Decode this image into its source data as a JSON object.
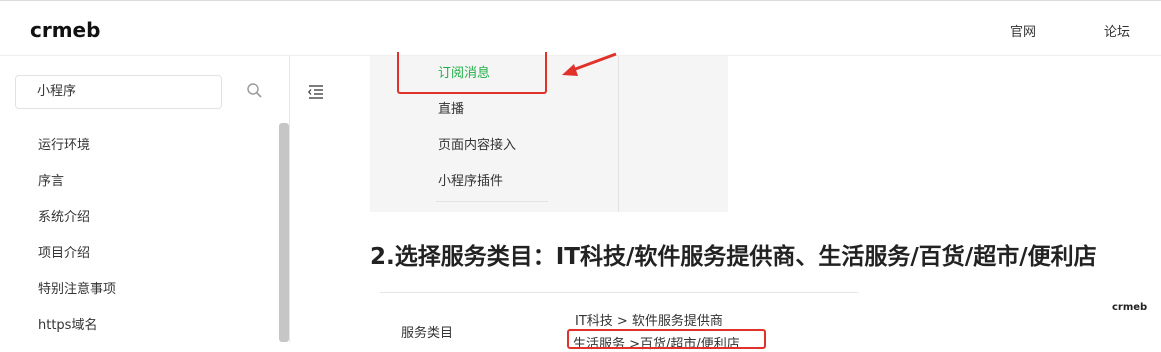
{
  "header": {
    "logo_text": "crmeb",
    "nav": [
      {
        "label": "官网"
      },
      {
        "label": "论坛"
      }
    ]
  },
  "sidebar": {
    "search_value": "小程序",
    "items": [
      {
        "label": "运行环境"
      },
      {
        "label": "序言"
      },
      {
        "label": "系统介绍"
      },
      {
        "label": "项目介绍"
      },
      {
        "label": "特别注意事项"
      },
      {
        "label": "https域名"
      }
    ]
  },
  "content": {
    "screenshot_menu": [
      {
        "label": "订阅消息",
        "active": true
      },
      {
        "label": "直播"
      },
      {
        "label": "页面内容接入"
      },
      {
        "label": "小程序插件"
      }
    ],
    "heading": "2.选择服务类目：IT科技/软件服务提供商、生活服务/百货/超市/便利店",
    "table": {
      "label": "服务类目",
      "value1": "IT科技 > 软件服务提供商",
      "value2": "生活服务 >百货/超市/便利店"
    },
    "watermark": "crmeb"
  },
  "colors": {
    "accent_green": "#21b04a",
    "highlight_red": "#e0322b"
  }
}
